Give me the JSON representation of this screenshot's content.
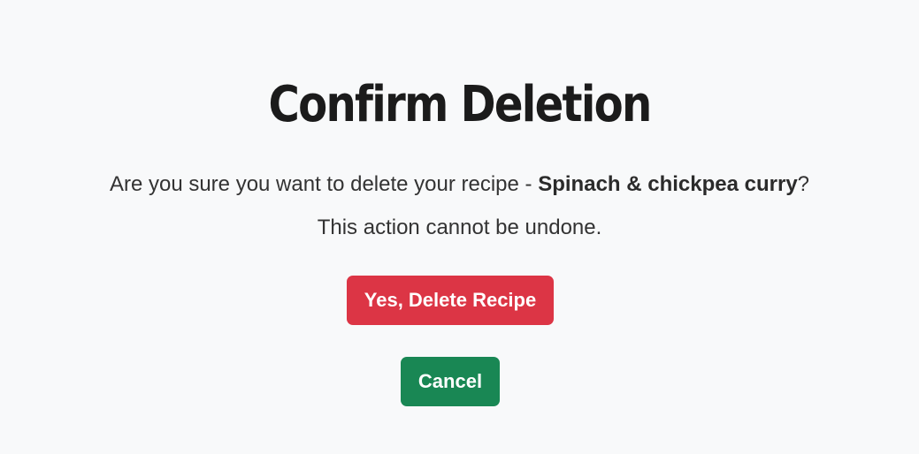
{
  "page": {
    "title": "Confirm Deletion",
    "prompt_prefix": "Are you sure you want to delete your recipe - ",
    "recipe_name": "Spinach & chickpea curry",
    "prompt_suffix": "?",
    "warning": "This action cannot be undone."
  },
  "actions": {
    "delete_label": "Yes, Delete Recipe",
    "cancel_label": "Cancel"
  },
  "colors": {
    "background": "#f8f9fa",
    "delete": "#dc3545",
    "cancel": "#198754"
  }
}
